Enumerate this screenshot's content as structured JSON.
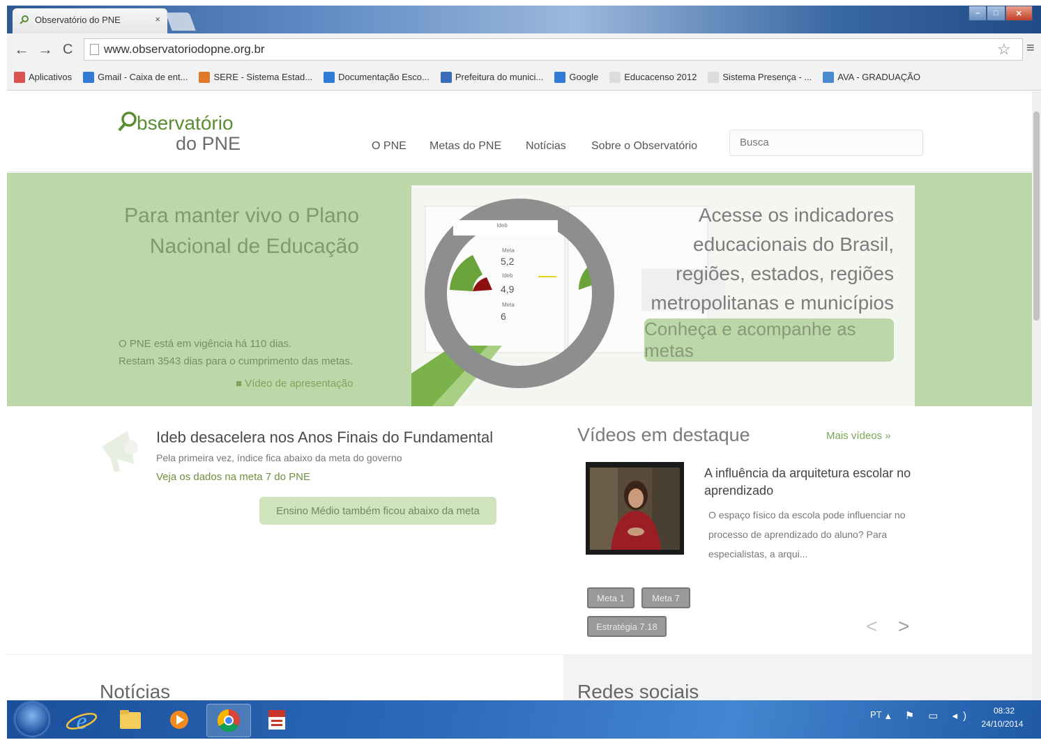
{
  "browser": {
    "tab_title": "Observatório do PNE",
    "tab_close": "×",
    "url": "www.observatoriodopne.org.br",
    "bookmarks": [
      {
        "label": "Aplicativos",
        "color": "#d9534f"
      },
      {
        "label": "Gmail - Caixa de ent...",
        "color": "#2f7bd6"
      },
      {
        "label": "SERE - Sistema Estad...",
        "color": "#e07a2a"
      },
      {
        "label": "Documentação Esco...",
        "color": "#2f7bd6"
      },
      {
        "label": "Prefeitura do munici...",
        "color": "#3a6db8"
      },
      {
        "label": "Google",
        "color": "#2f7bd6"
      },
      {
        "label": "Educacenso 2012",
        "color": "#dddddd"
      },
      {
        "label": "Sistema Presença - ...",
        "color": "#dddddd"
      },
      {
        "label": "AVA - GRADUAÇÃO",
        "color": "#4a8bd0"
      }
    ]
  },
  "site": {
    "logo_line1": "bservatório",
    "logo_line2": "do PNE",
    "nav": [
      "O PNE",
      "Metas do PNE",
      "Notícias",
      "Sobre o Observatório"
    ],
    "search_placeholder": "Busca"
  },
  "hero": {
    "title": "Para manter vivo o Plano Nacional de Educação",
    "info_line1": "O PNE está em vigência há 110 dias.",
    "info_line2": "Restam 3543 dias para o cumprimento das metas.",
    "video_link": "Vídeo de apresentação",
    "panel_text": "Acesse os indicadores educacionais do Brasil, regiões, estados, regiões metropolitanas e municípios",
    "button": "Conheça e acompanhe as metas",
    "gauge_values": [
      "5,2",
      "4,9",
      "6"
    ]
  },
  "news": {
    "headline": "Ideb desacelera nos Anos Finais do Fundamental",
    "subtitle": "Pela primeira vez, índice fica abaixo da meta do governo",
    "link": "Veja os dados na meta 7 do PNE",
    "button": "Ensino Médio também ficou abaixo da meta"
  },
  "videos": {
    "title": "Vídeos em destaque",
    "more": "Mais vídeos »",
    "item_title": "A influência da arquitetura escolar no aprendizado",
    "item_desc": "O espaço físico da escola pode influenciar no processo de aprendizado do aluno? Para especialistas, a arqui...",
    "tags": [
      "Meta 1",
      "Meta 7",
      "Estratégia 7.18"
    ],
    "prev": "<",
    "next": ">"
  },
  "sections": {
    "noticias": "Notícias",
    "redes": "Redes sociais"
  },
  "taskbar": {
    "lang": "PT",
    "time": "08:32",
    "date": "24/10/2014"
  },
  "colors": {
    "brand_green": "#5a8c32",
    "hero_bg": "#bcd8a8",
    "taskbar_blue": "#2c69b8"
  }
}
